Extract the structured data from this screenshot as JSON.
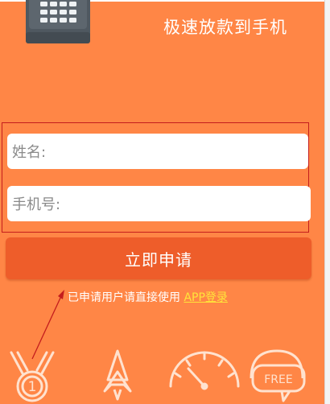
{
  "header": {
    "slogan": "极速放款到手机"
  },
  "form": {
    "name_placeholder": "姓名:",
    "phone_placeholder": "手机号:",
    "submit_label": "立即申请"
  },
  "login_hint": {
    "text": "已申请用户请直接使用",
    "link_label": "APP登录"
  },
  "features": {
    "icons": [
      "medal-icon",
      "rocket-icon",
      "speedometer-icon",
      "free-badge-icon"
    ],
    "free_label": "FREE",
    "medal_number": "1"
  },
  "colors": {
    "background": "#ff8646",
    "button": "#ee5d2a",
    "link": "#ffe43a",
    "highlight_box": "#c41d1d"
  }
}
